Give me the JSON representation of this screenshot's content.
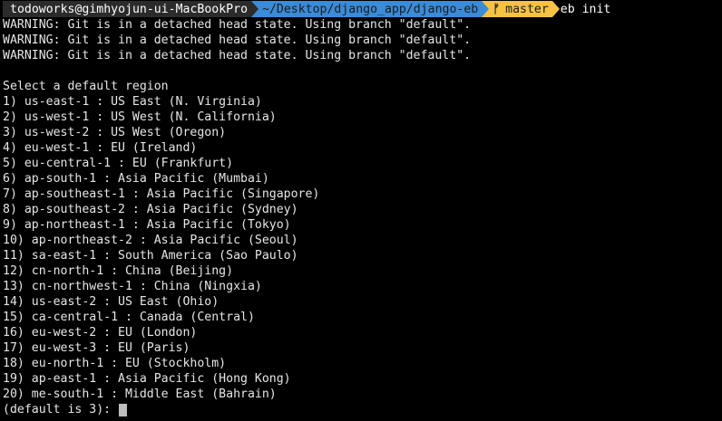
{
  "prompt": {
    "user_host": "todoworks@gimhyojun-ui-MacBookPro",
    "cwd": "~/Desktop/django_app/django-eb",
    "branch_icon": "git-branch-icon",
    "branch": "master",
    "command": "eb init"
  },
  "warnings": [
    "WARNING: Git is in a detached head state. Using branch \"default\".",
    "WARNING: Git is in a detached head state. Using branch \"default\".",
    "WARNING: Git is in a detached head state. Using branch \"default\"."
  ],
  "region_prompt": "Select a default region",
  "regions": [
    "1) us-east-1 : US East (N. Virginia)",
    "2) us-west-1 : US West (N. California)",
    "3) us-west-2 : US West (Oregon)",
    "4) eu-west-1 : EU (Ireland)",
    "5) eu-central-1 : EU (Frankfurt)",
    "6) ap-south-1 : Asia Pacific (Mumbai)",
    "7) ap-southeast-1 : Asia Pacific (Singapore)",
    "8) ap-southeast-2 : Asia Pacific (Sydney)",
    "9) ap-northeast-1 : Asia Pacific (Tokyo)",
    "10) ap-northeast-2 : Asia Pacific (Seoul)",
    "11) sa-east-1 : South America (Sao Paulo)",
    "12) cn-north-1 : China (Beijing)",
    "13) cn-northwest-1 : China (Ningxia)",
    "14) us-east-2 : US East (Ohio)",
    "15) ca-central-1 : Canada (Central)",
    "16) eu-west-2 : EU (London)",
    "17) eu-west-3 : EU (Paris)",
    "18) eu-north-1 : EU (Stockholm)",
    "19) ap-east-1 : Asia Pacific (Hong Kong)",
    "20) me-south-1 : Middle East (Bahrain)"
  ],
  "input_prompt": "(default is 3): ",
  "colors": {
    "background": "#000000",
    "text": "#e6e6e6",
    "user_segment": "#2b2b2b",
    "dir_segment": "#3a8bd8",
    "git_segment": "#f7c244"
  }
}
